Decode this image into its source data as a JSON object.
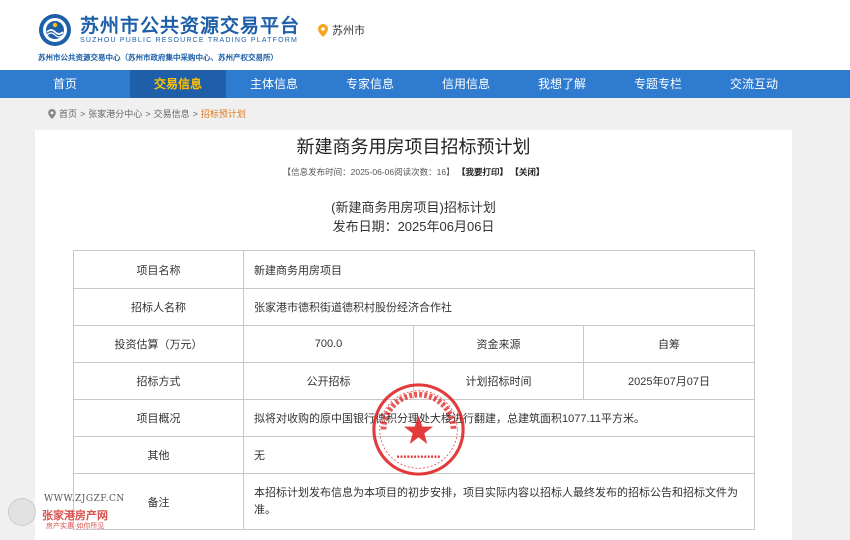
{
  "header": {
    "site_title": "苏州市公共资源交易平台",
    "site_title_en": "SUZHOU PUBLIC RESOURCE TRADING PLATFORM",
    "site_subtitle": "苏州市公共资源交易中心（苏州市政府集中采购中心、苏州产权交易所）",
    "location": "苏州市",
    "brand_color": "#1d5fa8"
  },
  "nav": {
    "bg_color": "#2e7bd0",
    "active_color": "#ffc000",
    "items": [
      {
        "label": "首页",
        "active": false
      },
      {
        "label": "交易信息",
        "active": true
      },
      {
        "label": "主体信息",
        "active": false
      },
      {
        "label": "专家信息",
        "active": false
      },
      {
        "label": "信用信息",
        "active": false
      },
      {
        "label": "我想了解",
        "active": false
      },
      {
        "label": "专题专栏",
        "active": false
      },
      {
        "label": "交流互动",
        "active": false
      }
    ]
  },
  "breadcrumb": {
    "items": [
      "首页",
      "张家港分中心",
      "交易信息"
    ],
    "separator": ">",
    "current": "招标预计划"
  },
  "article": {
    "title": "新建商务用房项目招标预计划",
    "meta": {
      "prefix": "【信息发布时间：",
      "date": "2025-06-06",
      "views_label": "阅读次数：",
      "views": "16",
      "suffix": "】",
      "print": "【我要打印】",
      "close": "【关闭】"
    },
    "plan_title": "(新建商务用房项目)招标计划",
    "plan_date": "发布日期：2025年06月06日"
  },
  "table": {
    "project_name_label": "项目名称",
    "project_name": "新建商务用房项目",
    "tenderer_label": "招标人名称",
    "tenderer": "张家港市德积街道德积村股份经济合作社",
    "investment_label": "投资估算（万元）",
    "investment": "700.0",
    "fund_source_label": "资金来源",
    "fund_source": "自筹",
    "method_label": "招标方式",
    "method": "公开招标",
    "plan_time_label": "计划招标时间",
    "plan_time": "2025年07月07日",
    "overview_label": "项目概况",
    "overview": "拟将对收购的原中国银行德积分理处大楼进行翻建，总建筑面积1077.11平方米。",
    "other_label": "其他",
    "other": "无",
    "remark_label": "备注",
    "remark": "本招标计划发布信息为本项目的初步安排，项目实际内容以招标人最终发布的招标公告和招标文件为准。"
  },
  "seal": {
    "color": "#e02020"
  },
  "watermark": {
    "url": "WWW.ZJGZF.CN",
    "name": "张家港房产网",
    "slogan": "房产实惠·如你所见"
  }
}
